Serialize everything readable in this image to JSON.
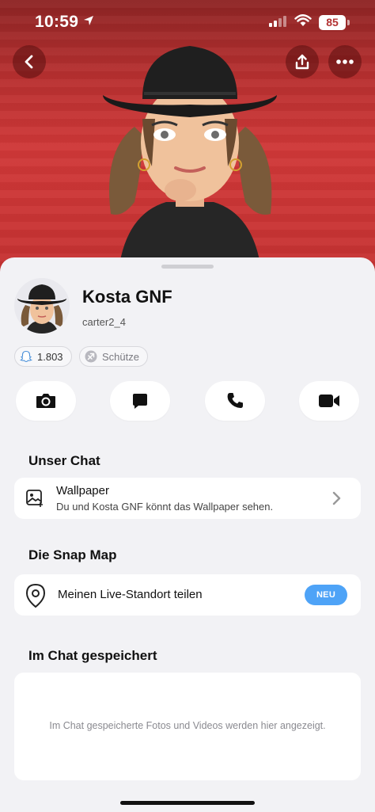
{
  "status_bar": {
    "time": "10:59",
    "battery": "85"
  },
  "profile": {
    "display_name": "Kosta GNF",
    "username": "carter2_4",
    "snap_score": "1.803",
    "zodiac": "Schütze"
  },
  "actions": [
    {
      "icon": "camera-icon"
    },
    {
      "icon": "chat-icon"
    },
    {
      "icon": "phone-icon"
    },
    {
      "icon": "video-icon"
    }
  ],
  "sections": {
    "chat": {
      "title": "Unser Chat",
      "wallpaper_title": "Wallpaper",
      "wallpaper_sub": "Du und Kosta GNF könnt das Wallpaper sehen."
    },
    "map": {
      "title": "Die Snap Map",
      "live_location": "Meinen Live-Standort teilen",
      "badge": "NEU"
    },
    "saved": {
      "title": "Im Chat gespeichert",
      "empty_text": "Im Chat gespeicherte Fotos und Videos werden hier angezeigt."
    }
  },
  "colors": {
    "hero_red": "#c53232",
    "badge_blue": "#4ea3f7",
    "sheet_bg": "#f2f2f5"
  }
}
